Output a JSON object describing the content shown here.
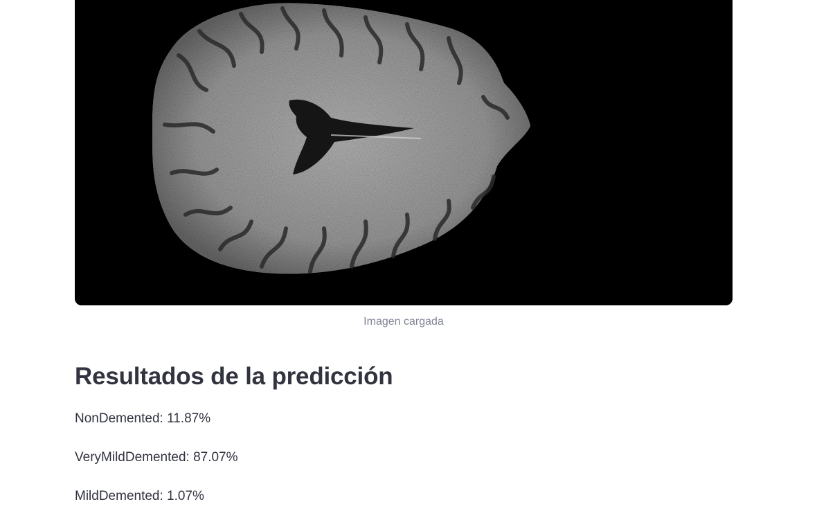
{
  "image": {
    "caption": "Imagen cargada"
  },
  "results": {
    "heading": "Resultados de la predicción",
    "lines": [
      "NonDemented: 11.87%",
      "VeryMildDemented: 87.07%",
      "MildDemented: 1.07%"
    ]
  }
}
